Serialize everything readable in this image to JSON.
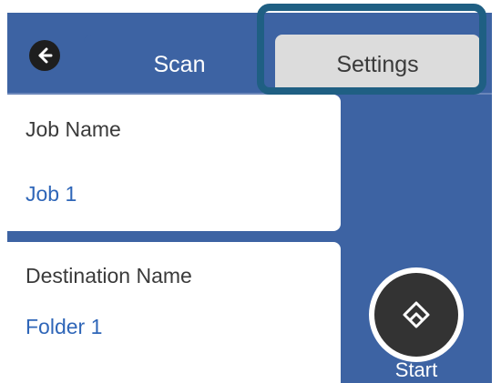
{
  "tabs": {
    "scan": "Scan",
    "settings": "Settings"
  },
  "fields": [
    {
      "label": "Job Name",
      "value": "Job 1"
    },
    {
      "label": "Destination Name",
      "value": "Folder 1"
    }
  ],
  "actions": {
    "back_icon": "arrow-left-icon",
    "start_icon": "start-diamond-icon",
    "start_label": "Start"
  },
  "colors": {
    "panel_blue": "#3d63a3",
    "highlight": "#1f5f83",
    "value_text": "#2f66b8",
    "tab_inactive": "#dcdcdc"
  }
}
